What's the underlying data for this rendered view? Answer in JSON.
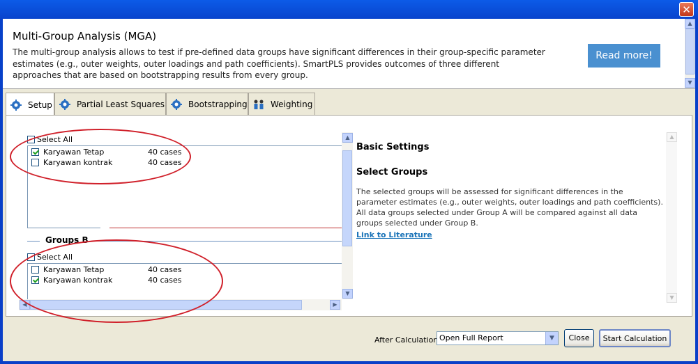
{
  "window": {
    "close_glyph": "✕"
  },
  "header": {
    "title": "Multi-Group Analysis (MGA)",
    "description": "The multi-group analysis allows to test if pre-defined data groups have significant differences in their group-specific parameter estimates (e.g., outer weights, outer loadings and path coefficients). SmartPLS provides outcomes of three different approaches that are based on bootstrapping results from every group.",
    "read_more": "Read more!"
  },
  "tabs": [
    {
      "label": "Setup",
      "icon": "gear-icon"
    },
    {
      "label": "Partial Least Squares",
      "icon": "gear-icon"
    },
    {
      "label": "Bootstrapping",
      "icon": "gear-icon"
    },
    {
      "label": "Weighting",
      "icon": "people-icon"
    }
  ],
  "group_a": {
    "select_all": "Select All",
    "rows": [
      {
        "name": "Karyawan Tetap",
        "cases": "40 cases",
        "checked": true
      },
      {
        "name": "Karyawan kontrak",
        "cases": "40 cases",
        "checked": false
      }
    ]
  },
  "group_b": {
    "title": "Groups B",
    "select_all": "Select All",
    "rows": [
      {
        "name": "Karyawan Tetap",
        "cases": "40 cases",
        "checked": false
      },
      {
        "name": "Karyawan kontrak",
        "cases": "40 cases",
        "checked": true
      }
    ]
  },
  "info": {
    "basic_settings": "Basic Settings",
    "select_groups": "Select Groups",
    "text": "The selected groups will be assessed for significant differences in the parameter estimates (e.g., outer weights, outer loadings and path coefficients). All data groups selected under Group A will be compared against all data groups selected under Group B.",
    "link": "Link to Literature"
  },
  "footer": {
    "after_label": "After Calculation:",
    "after_value": "Open Full Report",
    "close": "Close",
    "start": "Start Calculation"
  }
}
